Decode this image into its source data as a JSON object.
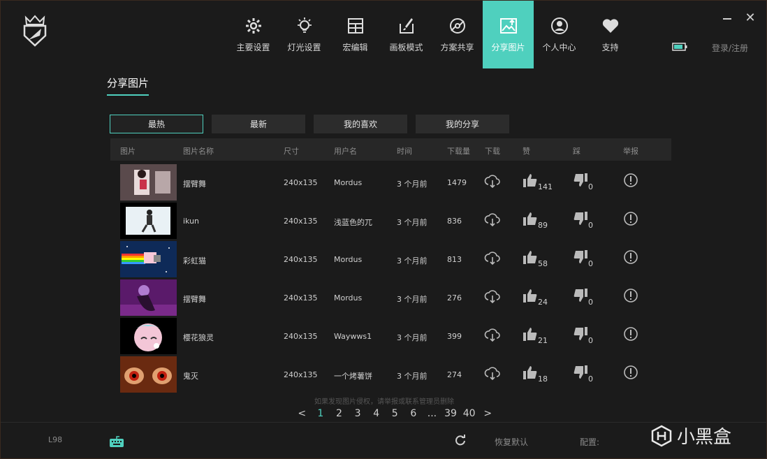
{
  "nav": [
    {
      "label": "主要设置",
      "icon": "gear-icon"
    },
    {
      "label": "灯光设置",
      "icon": "bulb-icon"
    },
    {
      "label": "宏编辑",
      "icon": "grid-icon"
    },
    {
      "label": "画板模式",
      "icon": "paint-icon"
    },
    {
      "label": "方案共享",
      "icon": "share-disc-icon"
    },
    {
      "label": "分享图片",
      "icon": "image-upload-icon"
    },
    {
      "label": "个人中心",
      "icon": "user-icon"
    },
    {
      "label": "支持",
      "icon": "heart-icon"
    }
  ],
  "active_nav": "分享图片",
  "login": "登录/注册",
  "page_title": "分享图片",
  "tabs": [
    "最热",
    "最新",
    "我的喜欢",
    "我的分享"
  ],
  "columns": [
    "图片",
    "图片名称",
    "尺寸",
    "用户名",
    "时间",
    "下载量",
    "下载",
    "赞",
    "踩",
    "举报"
  ],
  "rows": [
    {
      "name": "摆臂舞",
      "size": "240x135",
      "user": "Mordus",
      "time": "3 个月前",
      "downloads": "1479",
      "likes": "141",
      "dislikes": "0"
    },
    {
      "name": "ikun",
      "size": "240x135",
      "user": "浅蓝色的兀",
      "time": "3 个月前",
      "downloads": "836",
      "likes": "89",
      "dislikes": "0"
    },
    {
      "name": "彩虹猫",
      "size": "240x135",
      "user": "Mordus",
      "time": "3 个月前",
      "downloads": "813",
      "likes": "58",
      "dislikes": "0"
    },
    {
      "name": "摆臂舞",
      "size": "240x135",
      "user": "Mordus",
      "time": "3 个月前",
      "downloads": "276",
      "likes": "24",
      "dislikes": "0"
    },
    {
      "name": "樱花狼灵",
      "size": "240x135",
      "user": "Waywws1",
      "time": "3 个月前",
      "downloads": "399",
      "likes": "21",
      "dislikes": "0"
    },
    {
      "name": "鬼灭",
      "size": "240x135",
      "user": "一个烤薯饼",
      "time": "3 个月前",
      "downloads": "274",
      "likes": "18",
      "dislikes": "0"
    }
  ],
  "notice": "如果发现图片侵权，请举报或联系管理员删除",
  "pager": [
    "<",
    "1",
    "2",
    "3",
    "4",
    "5",
    "6",
    "...",
    "39",
    "40",
    ">"
  ],
  "current_page": "1",
  "footer": {
    "model": "L98",
    "restore": "恢复默认",
    "config": "配置:",
    "watermark": "小黑盒"
  },
  "colors": {
    "accent": "#4fd0be",
    "bg": "#1b1b1b"
  }
}
